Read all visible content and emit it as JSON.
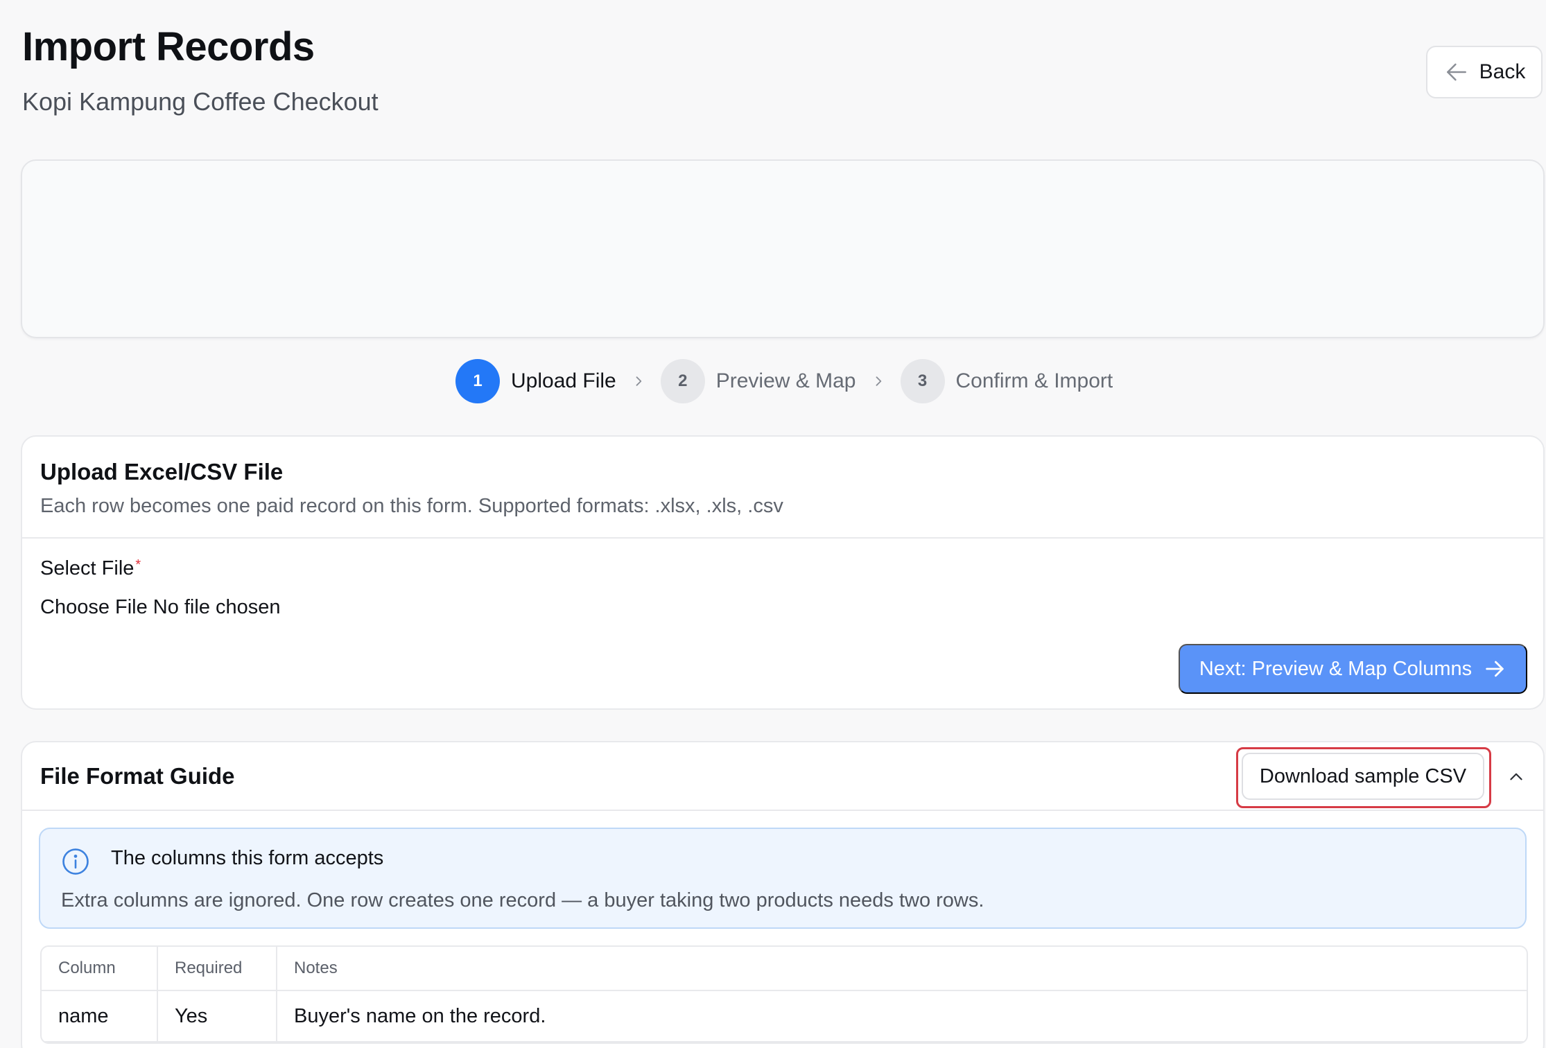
{
  "header": {
    "title": "Import Records",
    "subtitle": "Kopi Kampung Coffee Checkout",
    "back_label": "Back"
  },
  "stepper": {
    "steps": [
      {
        "number": "1",
        "label": "Upload File",
        "active": true
      },
      {
        "number": "2",
        "label": "Preview & Map",
        "active": false
      },
      {
        "number": "3",
        "label": "Confirm & Import",
        "active": false
      }
    ]
  },
  "upload": {
    "title": "Upload Excel/CSV File",
    "description": "Each row becomes one paid record on this form. Supported formats: .xlsx, .xls, .csv",
    "select_label": "Select File",
    "required_mark": "*",
    "choose_file_label": "Choose File",
    "no_file_text": "No file chosen",
    "next_label": "Next: Preview & Map Columns"
  },
  "guide": {
    "title": "File Format Guide",
    "download_label": "Download sample CSV",
    "info_title": "The columns this form accepts",
    "info_desc": "Extra columns are ignored. One row creates one record — a buyer taking two products needs two rows.",
    "table": {
      "headers": [
        "Column",
        "Required",
        "Notes"
      ],
      "rows": [
        [
          "name",
          "Yes",
          "Buyer's name on the record."
        ]
      ]
    }
  },
  "icons": {
    "back": "arrow-left-icon",
    "step_separator": "chevron-right-icon",
    "next": "arrow-right-icon",
    "collapse": "chevron-up-icon",
    "info": "info-icon"
  },
  "colors": {
    "accent": "#2378f7",
    "next_button": "#5a93f8",
    "highlight": "#d63b45",
    "info_bg": "#eef5fe"
  }
}
